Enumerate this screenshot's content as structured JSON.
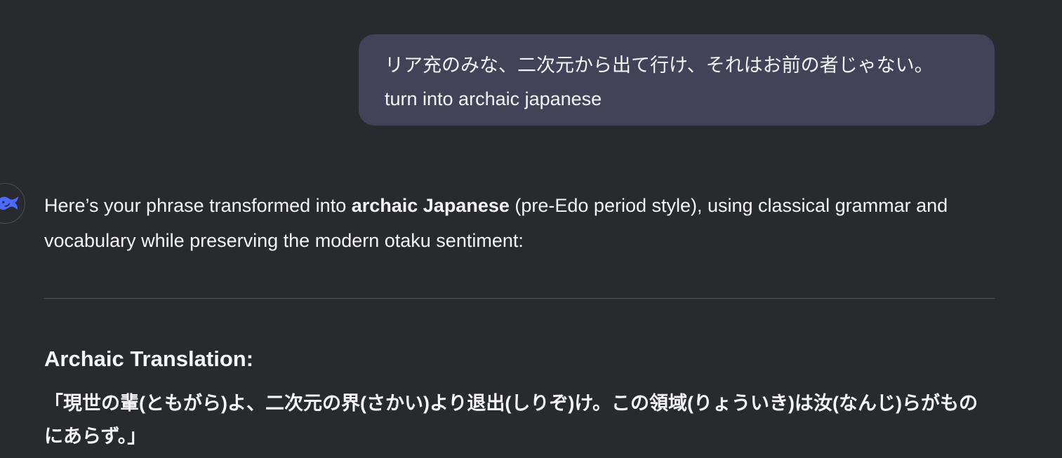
{
  "user_message": {
    "line1": "リア充のみな、二次元から出て行け、それはお前の者じゃない。",
    "line2": "turn into archaic japanese"
  },
  "assistant": {
    "avatar_icon": "whale-logo-icon",
    "intro_before": "Here’s your phrase transformed into ",
    "intro_bold": "archaic Japanese",
    "intro_after": " (pre-Edo period style), using classical grammar and vocabulary while preserving the modern otaku sentiment:",
    "heading": "Archaic Translation:",
    "translation": "「現世の輩(ともがら)よ、二次元の界(さかい)より退出(しりぞ)け。この領域(りょういき)は汝(なんじ)らがものにあらず。」"
  },
  "colors": {
    "background": "#292a2d",
    "user_bubble": "#424259",
    "accent": "#4d6bfe"
  }
}
